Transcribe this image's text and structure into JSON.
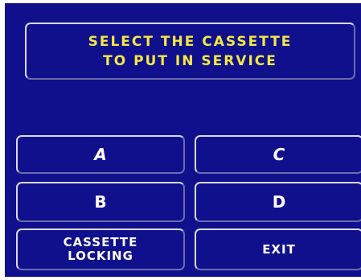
{
  "header": {
    "line1": "SELECT THE CASSETTE",
    "line2": "TO PUT IN SERVICE"
  },
  "buttons": {
    "a": "A",
    "b": "B",
    "c": "C",
    "d": "D",
    "cassette_locking_line1": "CASSETTE",
    "cassette_locking_line2": "LOCKING",
    "exit": "EXIT"
  },
  "colors": {
    "screen_background": "#10108c",
    "title_text": "#f4e843",
    "button_text": "#ffffff"
  }
}
